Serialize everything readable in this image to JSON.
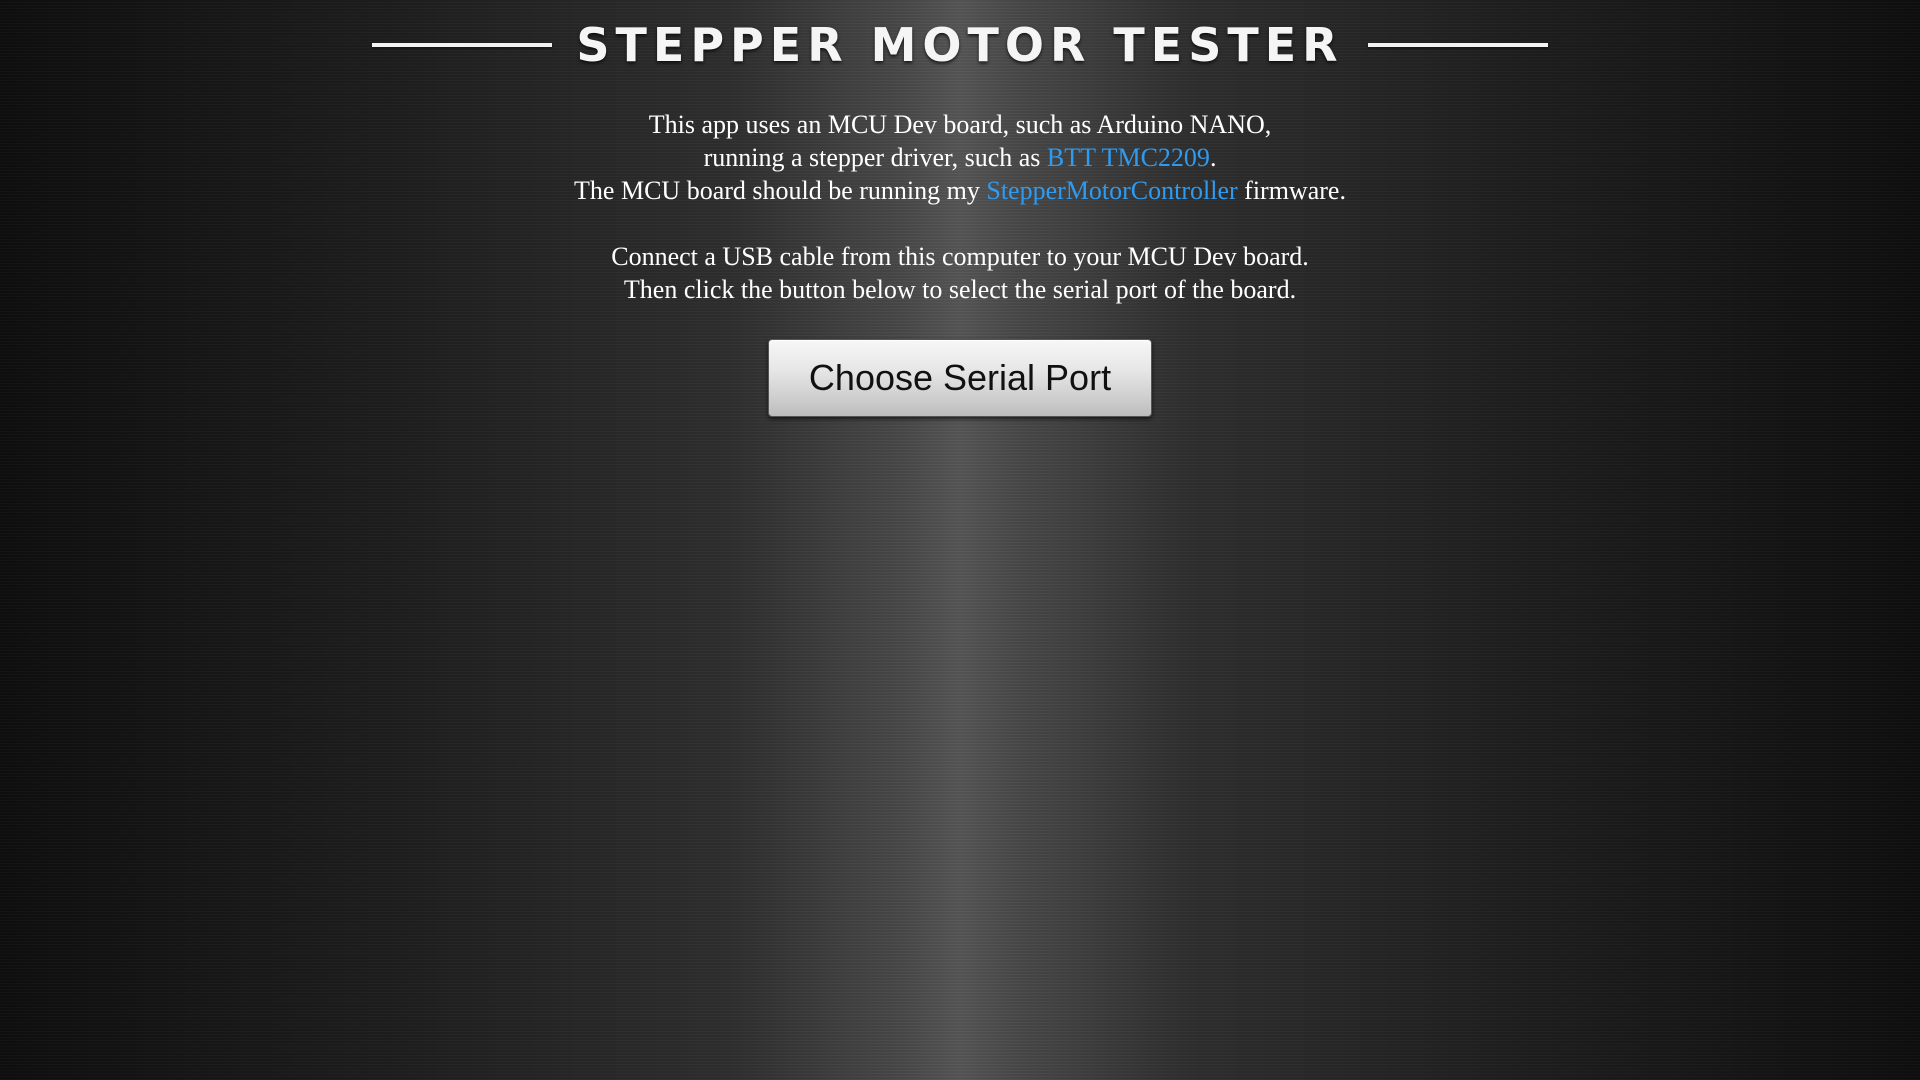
{
  "header": {
    "title": "STEPPER MOTOR TESTER"
  },
  "intro": {
    "line1": "This app uses an MCU Dev board, such as Arduino NANO,",
    "line2_prefix": "running a stepper driver, such as ",
    "line2_link": "BTT TMC2209",
    "line2_suffix": ".",
    "line3_prefix": "The MCU board should be running my ",
    "line3_link": "StepperMotorController",
    "line3_suffix": " firmware.",
    "line4": "Connect a USB cable from this computer to your MCU Dev board.",
    "line5": "Then click the button below to select the serial port of the board."
  },
  "actions": {
    "choose_port_label": "Choose Serial Port"
  },
  "colors": {
    "link": "#2f9bf0",
    "text": "#ffffff"
  }
}
